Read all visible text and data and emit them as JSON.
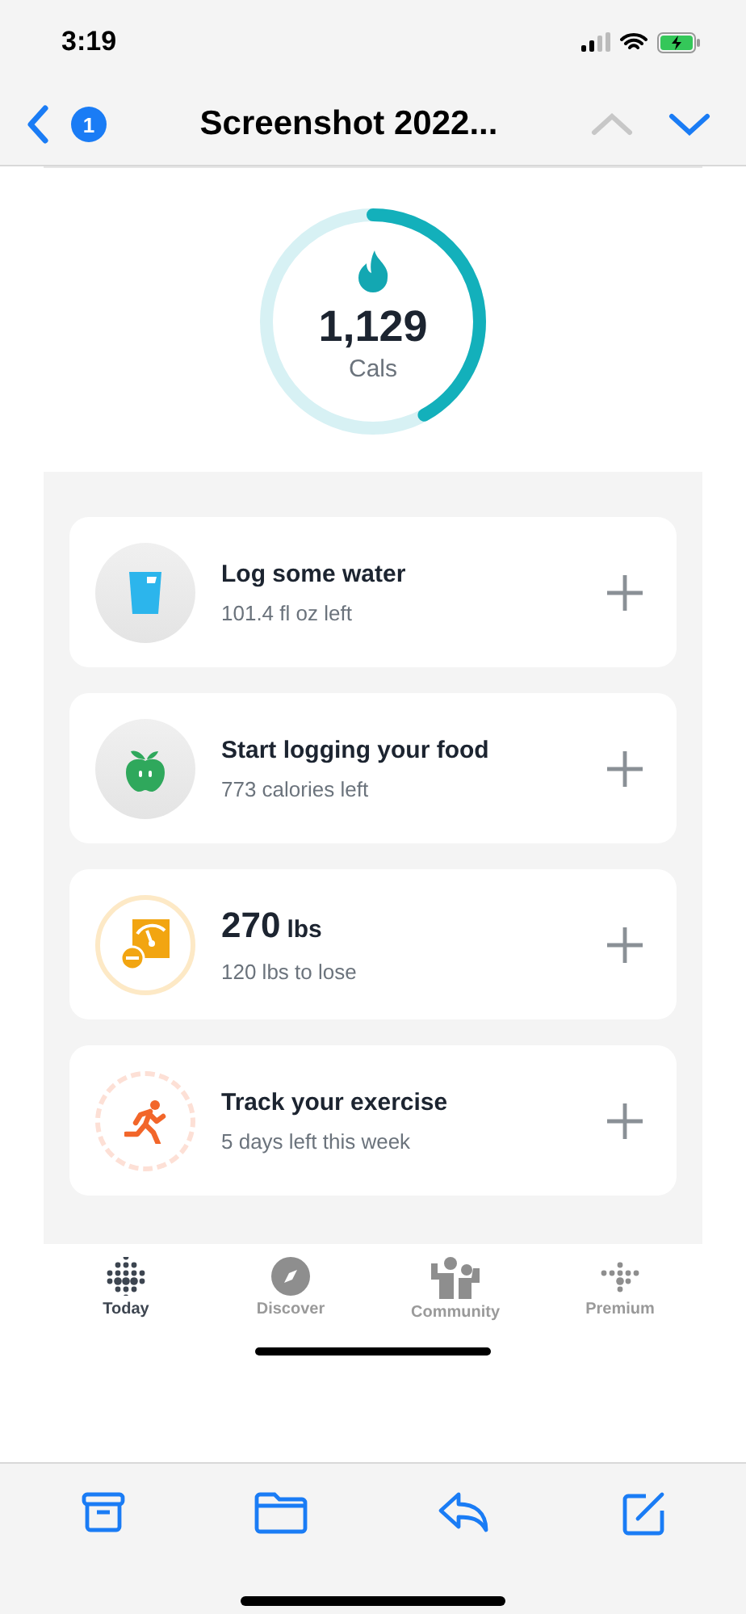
{
  "status_bar": {
    "time": "3:19"
  },
  "nav_bar": {
    "badge": "1",
    "title": "Screenshot 2022...",
    "up_enabled": false,
    "down_enabled": true
  },
  "calories": {
    "value": "1,129",
    "unit": "Cals",
    "level": 0.42
  },
  "cards": [
    {
      "kind": "water",
      "title": "Log some water",
      "subtitle": "101.4 fl oz left"
    },
    {
      "kind": "food",
      "title": "Start logging your food",
      "subtitle": "773 calories left"
    },
    {
      "kind": "weight",
      "value": "270",
      "unit": "lbs",
      "subtitle": "120 lbs to lose"
    },
    {
      "kind": "exercise",
      "title": "Track your exercise",
      "subtitle": "5 days left this week"
    }
  ],
  "tabs": [
    {
      "kind": "today",
      "label": "Today",
      "selected": true
    },
    {
      "kind": "discover",
      "label": "Discover",
      "selected": false
    },
    {
      "kind": "community",
      "label": "Community",
      "selected": false
    },
    {
      "kind": "premium",
      "label": "Premium",
      "selected": false
    }
  ]
}
